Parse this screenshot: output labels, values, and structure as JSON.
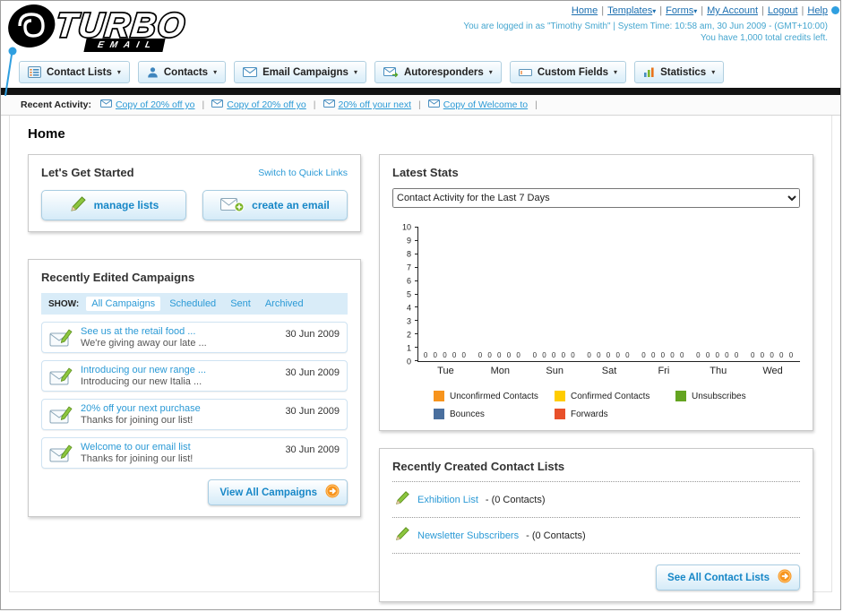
{
  "header": {
    "logo_turbo": "TURBO",
    "logo_email": "EMAIL",
    "links": [
      {
        "label": "Home",
        "caret": false
      },
      {
        "label": "Templates",
        "caret": true
      },
      {
        "label": "Forms",
        "caret": true
      },
      {
        "label": "My Account",
        "caret": false
      },
      {
        "label": "Logout",
        "caret": false
      },
      {
        "label": "Help",
        "caret": false
      }
    ],
    "login_info": "You are logged in as \"Timothy Smith\" | System Time: 10:58 am, 30 Jun 2009 - (GMT+10:00)",
    "credits": "You have 1,000 total credits left."
  },
  "nav_tabs": [
    {
      "label": "Contact Lists",
      "icon": "contact-lists-icon"
    },
    {
      "label": "Contacts",
      "icon": "contacts-icon"
    },
    {
      "label": "Email Campaigns",
      "icon": "email-campaigns-icon"
    },
    {
      "label": "Autoresponders",
      "icon": "autoresponders-icon"
    },
    {
      "label": "Custom Fields",
      "icon": "custom-fields-icon"
    },
    {
      "label": "Statistics",
      "icon": "statistics-icon"
    }
  ],
  "recent_activity": {
    "label": "Recent Activity:",
    "items": [
      "Copy of 20% off yo",
      "Copy of 20% off yo",
      "20% off your next",
      "Copy of Welcome to"
    ]
  },
  "page_title": "Home",
  "get_started": {
    "title": "Let's Get Started",
    "switch_link": "Switch to Quick Links",
    "manage_lists": "manage lists",
    "create_email": "create an email"
  },
  "campaigns": {
    "title": "Recently Edited Campaigns",
    "show_label": "SHOW:",
    "tabs": [
      "All Campaigns",
      "Scheduled",
      "Sent",
      "Archived"
    ],
    "selected_tab": "All Campaigns",
    "items": [
      {
        "title": "See us at the retail food ...",
        "subtitle": "We're giving away our late ...",
        "date": "30 Jun 2009"
      },
      {
        "title": "Introducing our new range ...",
        "subtitle": "Introducing our new Italia ...",
        "date": "30 Jun 2009"
      },
      {
        "title": "20% off your next purchase",
        "subtitle": "Thanks for joining our list!",
        "date": "30 Jun 2009"
      },
      {
        "title": "Welcome to our email list",
        "subtitle": "Thanks for joining our list!",
        "date": "30 Jun 2009"
      }
    ],
    "view_all_label": "View All Campaigns"
  },
  "stats": {
    "title": "Latest Stats",
    "selected_option": "Contact Activity for the Last 7 Days",
    "chart_data": {
      "type": "bar",
      "title": "Contact Activity for the Last 7 Days",
      "categories": [
        "Tue",
        "Mon",
        "Sun",
        "Sat",
        "Fri",
        "Thu",
        "Wed"
      ],
      "series": [
        {
          "name": "Unconfirmed Contacts",
          "color": "#f7941d",
          "values": [
            0,
            0,
            0,
            0,
            0,
            0,
            0
          ]
        },
        {
          "name": "Confirmed Contacts",
          "color": "#ffcc00",
          "values": [
            0,
            0,
            0,
            0,
            0,
            0,
            0
          ]
        },
        {
          "name": "Unsubscribes",
          "color": "#64a421",
          "values": [
            0,
            0,
            0,
            0,
            0,
            0,
            0
          ]
        },
        {
          "name": "Bounces",
          "color": "#4a6f9e",
          "values": [
            0,
            0,
            0,
            0,
            0,
            0,
            0
          ]
        },
        {
          "name": "Forwards",
          "color": "#e8502a",
          "values": [
            0,
            0,
            0,
            0,
            0,
            0,
            0
          ]
        }
      ],
      "xlabel": "",
      "ylabel": "",
      "ylim": [
        0,
        10
      ],
      "yticks": [
        0,
        1,
        2,
        3,
        4,
        5,
        6,
        7,
        8,
        9,
        10
      ],
      "grid": false,
      "legend_position": "bottom"
    }
  },
  "contact_lists": {
    "title": "Recently Created Contact Lists",
    "items": [
      {
        "name": "Exhibition List",
        "detail": "- (0 Contacts)"
      },
      {
        "name": "Newsletter Subscribers",
        "detail": "- (0 Contacts)"
      }
    ],
    "see_all_label": "See All Contact Lists"
  }
}
